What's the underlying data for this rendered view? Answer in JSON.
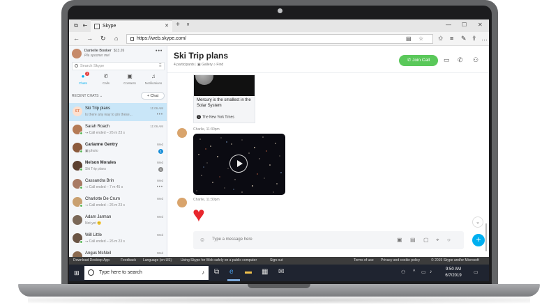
{
  "browser": {
    "tab_title": "Skype",
    "tab_close": "✕",
    "new_tab": "+",
    "tab_dropdown": "∨",
    "win_min": "—",
    "win_max": "☐",
    "win_close": "✕",
    "url": "https://web.skype.com/",
    "nav": {
      "back": "←",
      "forward": "→",
      "refresh": "↻",
      "home": "⌂"
    }
  },
  "profile": {
    "name": "Danielle Booker",
    "credit": "$13.26",
    "status": "Pla spooner me!"
  },
  "search": {
    "placeholder": "Search Skype",
    "dial": "⠿"
  },
  "nav_tabs": [
    {
      "label": "Chats",
      "icon": "●",
      "badge": "2"
    },
    {
      "label": "Calls",
      "icon": "✆"
    },
    {
      "label": "Contacts",
      "icon": "▣"
    },
    {
      "label": "Notifications",
      "icon": "♫"
    }
  ],
  "recent_header": "RECENT CHATS ⌄",
  "new_chat_label": "+ Chat",
  "chats": [
    {
      "avatar_text": "ST",
      "name": "Ski Trip plans",
      "preview": "Is there any way to pin these...",
      "time": "11:06 AM"
    },
    {
      "name": "Sarah Roach",
      "preview": "↝ Call ended – 26 m 23 s",
      "time": "11:06 AM",
      "avatar_color": "#b57a55"
    },
    {
      "name": "Carianne Gentry",
      "preview": "▣ photo",
      "time": "Wed",
      "badge": "1",
      "avatar_color": "#8c5a3c"
    },
    {
      "name": "Nelson Morales",
      "preview": "Ski Trip plans",
      "time": "Wed",
      "badge": "4",
      "avatar_color": "#5c4030"
    },
    {
      "name": "Cassandra Brin",
      "preview": "↝ Call ended – 7 m 45 s",
      "time": "Wed",
      "avatar_color": "#a87a64"
    },
    {
      "name": "Charlotte De Crum",
      "preview": "↝ Call ended – 26 m 23 s",
      "time": "Wed",
      "avatar_color": "#c9a070"
    },
    {
      "name": "Adam Jarman",
      "preview": "Not yet 🙂",
      "time": "Wed",
      "avatar_color": "#7a6858"
    },
    {
      "name": "Will Little",
      "preview": "↝ Call ended – 26 m 23 s",
      "time": "Wed",
      "avatar_color": "#6a5445"
    },
    {
      "name": "Angus McNeil",
      "preview": "",
      "time": "Wed",
      "avatar_color": "#8a6a50"
    }
  ],
  "conversation": {
    "title": "Ski Trip plans",
    "participants": "4 participants",
    "gallery": "Gallery",
    "find": "Find",
    "join_call": "Join Call",
    "link_card": {
      "title": "Mercury is the smallest in the Solar System",
      "source": "The New York Times"
    },
    "messages": [
      {
        "sender_time": "Charlie, 11:30pm"
      },
      {
        "sender_time": "Charlie, 11:30pm"
      }
    ],
    "heart": "♥",
    "compose_placeholder": "Type a message here",
    "send": "+",
    "scroll_down": "⌄"
  },
  "footer_links": [
    "Download Desktop App",
    "Feedback",
    "Language (en-US)",
    "Using Skype for Web safely on a public computer",
    "Sign out",
    "Terms of use",
    "Privacy and cookie policy",
    "© 2019 Skype and/or Microsoft"
  ],
  "taskbar": {
    "search_text": "Type here to search",
    "time": "9:50 AM",
    "date": "6/7/2019"
  }
}
